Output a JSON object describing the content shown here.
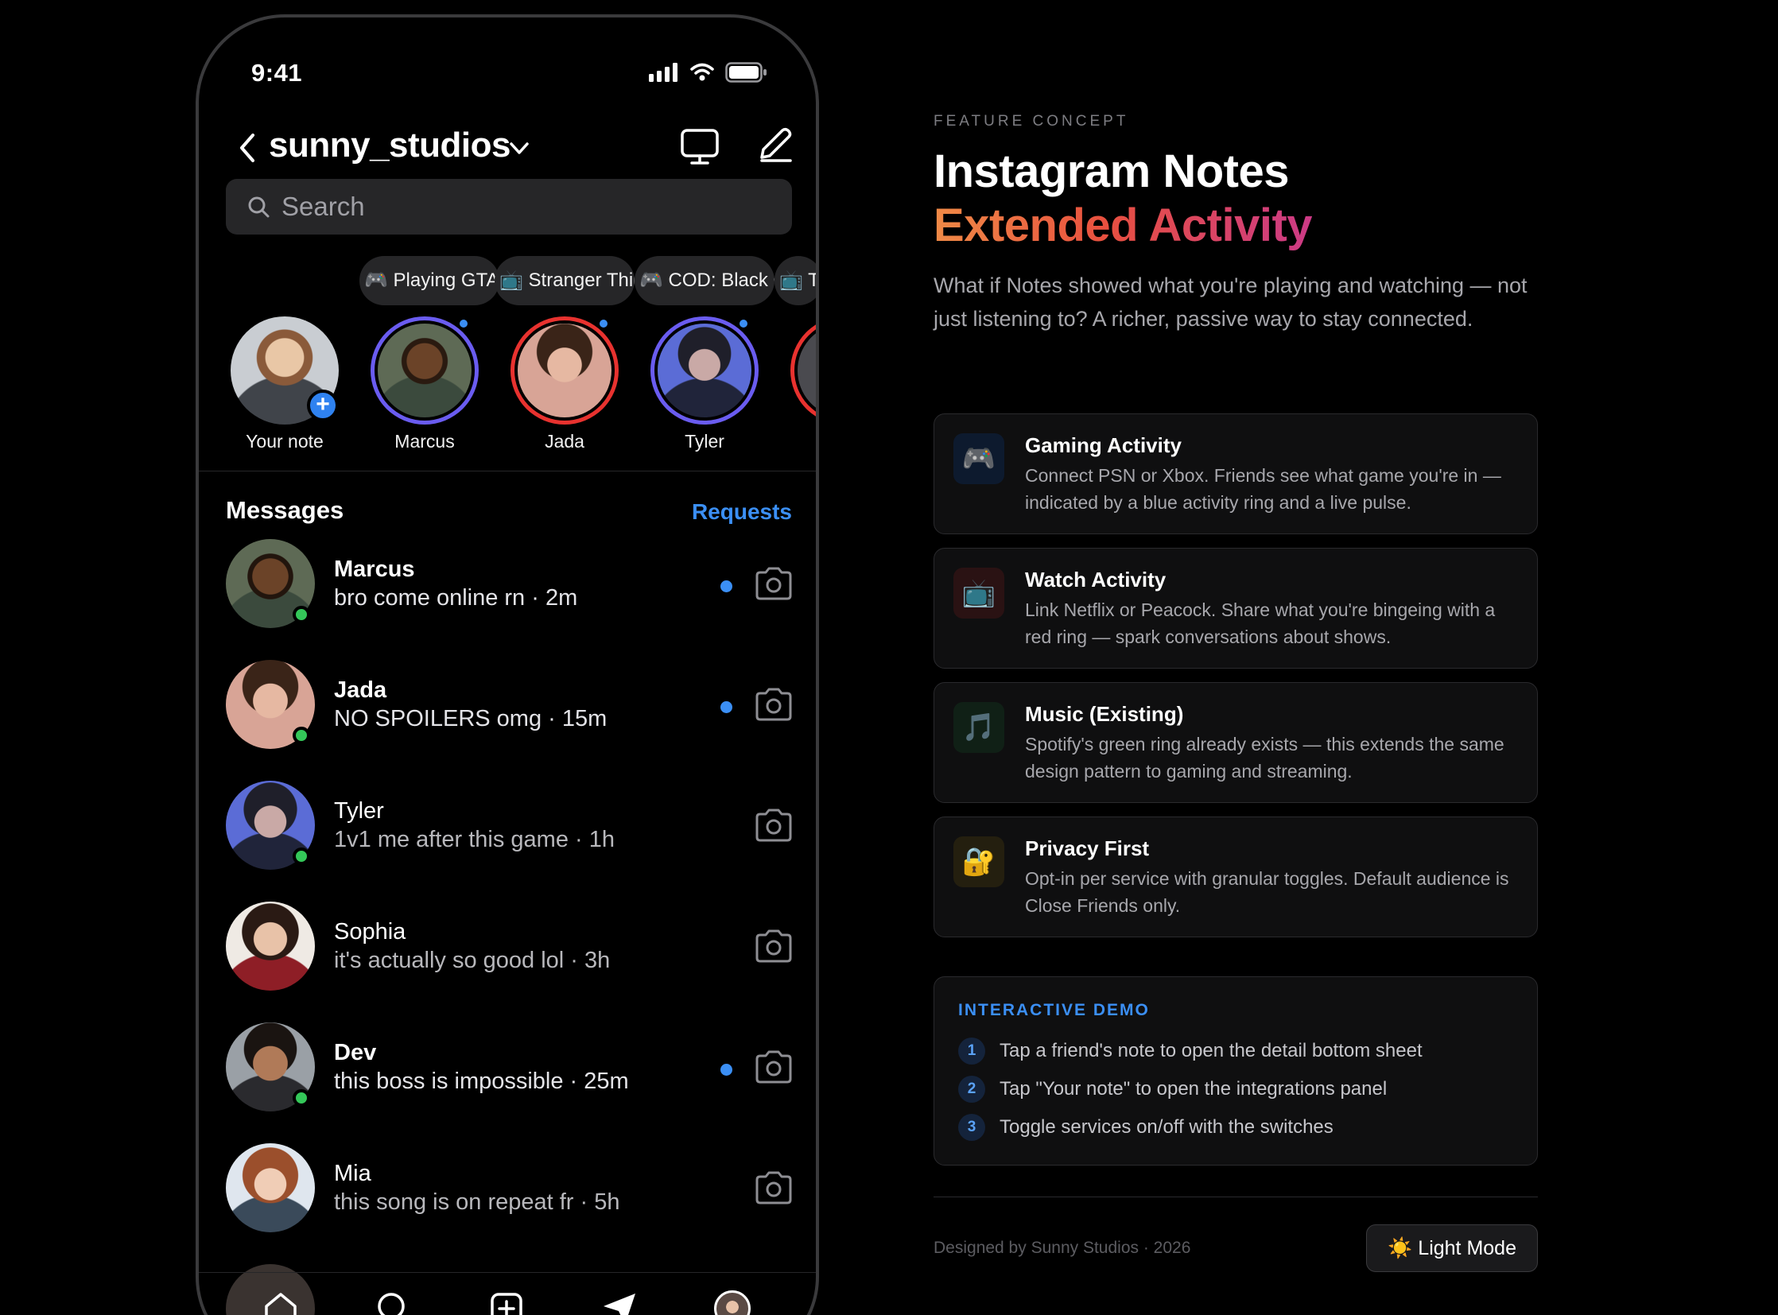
{
  "phone": {
    "status": {
      "time": "9:41"
    },
    "header": {
      "account": "sunny_studios"
    },
    "search": {
      "placeholder": "Search"
    },
    "notes": [
      {
        "bubble": "🎮 Playing GTA",
        "name": "Your note",
        "ring": "none",
        "has_add": true
      },
      {
        "bubble": "📺 Stranger Things",
        "name": "Marcus",
        "ring": "#6a5cf0",
        "activity": true
      },
      {
        "bubble": "🎮 COD: Black Ops",
        "name": "Jada",
        "ring": "#e8322f",
        "activity": true
      },
      {
        "bubble": "📺 The",
        "name": "Tyler",
        "ring": "#6a5cf0",
        "activity": true
      }
    ],
    "messages": {
      "title": "Messages",
      "requests": "Requests",
      "rows": [
        {
          "name": "Marcus",
          "preview": "bro come online rn · 2m",
          "unread": true,
          "online": true
        },
        {
          "name": "Jada",
          "preview": "NO SPOILERS omg · 15m",
          "unread": true,
          "online": true
        },
        {
          "name": "Tyler",
          "preview": "1v1 me after this game · 1h",
          "unread": false,
          "online": true
        },
        {
          "name": "Sophia",
          "preview": "it's actually so good lol · 3h",
          "unread": false,
          "online": false
        },
        {
          "name": "Dev",
          "preview": "this boss is impossible · 25m",
          "unread": true,
          "online": true
        },
        {
          "name": "Mia",
          "preview": "this song is on repeat fr · 5h",
          "unread": false,
          "online": false
        }
      ]
    },
    "colors": {
      "accent": "#3b8ff5",
      "online": "#34c759"
    }
  },
  "panel": {
    "eyebrow": "FEATURE CONCEPT",
    "title_line1": "Instagram Notes",
    "title_line2": "Extended Activity",
    "intro": "What if Notes showed what you're playing and watching — not just listening to? A richer, passive way to stay connected.",
    "features": [
      {
        "icon": "🎮",
        "icon_name": "gamepad-icon",
        "title": "Gaming Activity",
        "desc": "Connect PSN or Xbox. Friends see what game you're in — indicated by a blue activity ring and a live pulse.",
        "tint": "#0d1a2e"
      },
      {
        "icon": "📺",
        "icon_name": "tv-icon",
        "title": "Watch Activity",
        "desc": "Link Netflix or Peacock. Share what you're bingeing with a red ring — spark conversations about shows.",
        "tint": "#2a1213"
      },
      {
        "icon": "🎵",
        "icon_name": "music-note-icon",
        "title": "Music (Existing)",
        "desc": "Spotify's green ring already exists — this extends the same design pattern to gaming and streaming.",
        "tint": "#102016"
      },
      {
        "icon": "🔐",
        "icon_name": "lock-icon",
        "title": "Privacy First",
        "desc": "Opt-in per service with granular toggles. Default audience is Close Friends only.",
        "tint": "#241f0f"
      }
    ],
    "demo": {
      "title": "INTERACTIVE DEMO",
      "steps": [
        {
          "num": "1",
          "text": "Tap a friend's note to open the detail bottom sheet"
        },
        {
          "num": "2",
          "text": "Tap \"Your note\" to open the integrations panel"
        },
        {
          "num": "3",
          "text": "Toggle services on/off with the switches"
        }
      ]
    },
    "footer": {
      "credit": "Designed by Sunny Studios · 2026",
      "mode_button": "☀️ Light Mode"
    }
  }
}
